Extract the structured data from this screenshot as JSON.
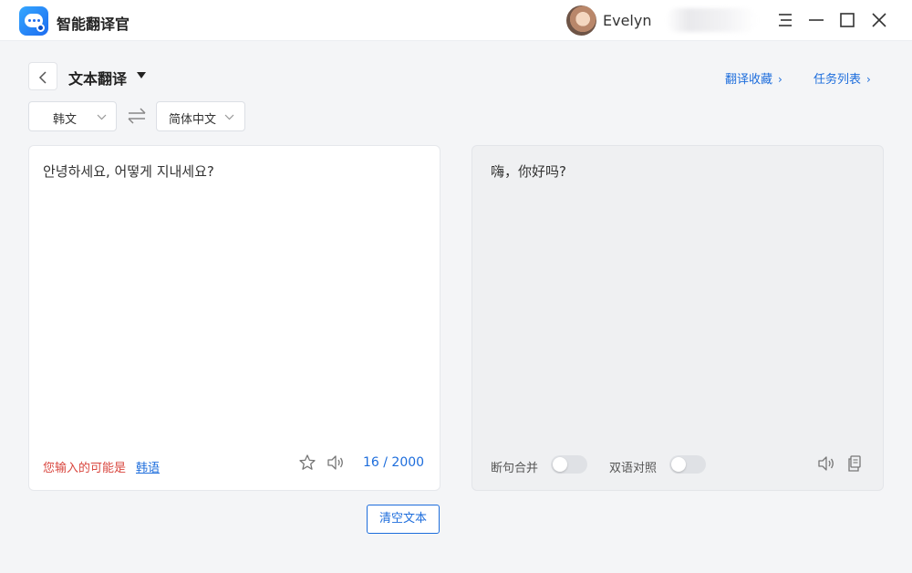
{
  "app": {
    "title": "智能翻译官"
  },
  "user": {
    "name": "Evelyn"
  },
  "toolbar": {
    "page_title": "文本翻译",
    "favorites_link": "翻译收藏",
    "tasks_link": "任务列表"
  },
  "languages": {
    "source": "韩文",
    "target": "简体中文"
  },
  "source_panel": {
    "text": "안녕하세요, 어떻게 지내세요?",
    "detect_prefix": "您输入的可能是",
    "detect_lang": "韩语",
    "char_count": "16 / 2000"
  },
  "target_panel": {
    "text": "嗨，你好吗?",
    "merge_label": "断句合并",
    "merge_on": false,
    "bilingual_label": "双语对照",
    "bilingual_on": false
  },
  "actions": {
    "clear_label": "清空文本"
  },
  "colors": {
    "accent": "#1d6ddc",
    "warning": "#d9463e",
    "background": "#f4f5f7",
    "target_panel_bg": "#eff0f2"
  }
}
